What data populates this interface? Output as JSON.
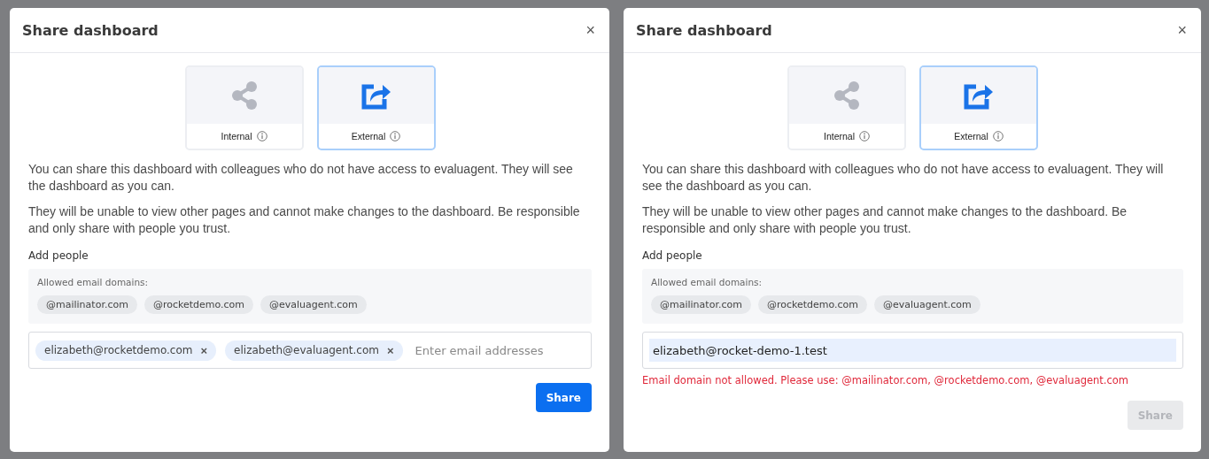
{
  "dialogs": [
    {
      "title": "Share dashboard",
      "close": "×",
      "share_types": [
        {
          "label": "Internal",
          "kind": "share",
          "selected": false
        },
        {
          "label": "External",
          "kind": "external",
          "selected": true
        }
      ],
      "paragraphs": [
        "You can share this dashboard with colleagues who do not have access to evaluagent. They will see the dashboard as you can.",
        "They will be unable to view other pages and cannot make changes to the dashboard. Be responsible and only share with people you trust."
      ],
      "add_people": "Add people",
      "allowed_domains": {
        "label": "Allowed email domains:",
        "domains": [
          "@mailinator.com",
          "@rocketdemo.com",
          "@evaluagent.com"
        ]
      },
      "email_field": {
        "chips": [
          {
            "text": "elizabeth@rocketdemo.com",
            "remove": "×"
          },
          {
            "text": "elizabeth@evaluagent.com",
            "remove": "×"
          }
        ],
        "placeholder": "Enter email addresses"
      },
      "share_button": {
        "label": "Share",
        "disabled": false
      }
    },
    {
      "title": "Share dashboard",
      "close": "×",
      "share_types": [
        {
          "label": "Internal",
          "kind": "share",
          "selected": false
        },
        {
          "label": "External",
          "kind": "external",
          "selected": true
        }
      ],
      "paragraphs": [
        "You can share this dashboard with colleagues who do not have access to evaluagent. They will see the dashboard as you can.",
        "They will be unable to view other pages and cannot make changes to the dashboard. Be responsible and only share with people you trust."
      ],
      "add_people": "Add people",
      "allowed_domains": {
        "label": "Allowed email domains:",
        "domains": [
          "@mailinator.com",
          "@rocketdemo.com",
          "@evaluagent.com"
        ]
      },
      "email_field": {
        "value": "elizabeth@rocket-demo-1.test",
        "autofilled": true
      },
      "error": "Email domain not allowed. Please use: @mailinator.com, @rocketdemo.com, @evaluagent.com",
      "share_button": {
        "label": "Share",
        "disabled": true
      }
    }
  ]
}
